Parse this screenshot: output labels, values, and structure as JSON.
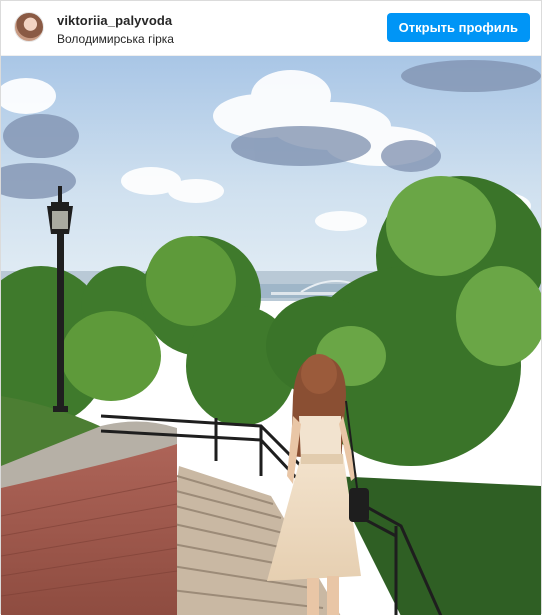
{
  "post": {
    "username": "viktoriia_palyvoda",
    "location": "Володимирська гірка",
    "profile_button_label": "Открыть профиль"
  },
  "colors": {
    "accent": "#0095f6",
    "text": "#262626",
    "border": "#dbdbdb"
  },
  "icons": {
    "avatar": "profile-photo"
  }
}
